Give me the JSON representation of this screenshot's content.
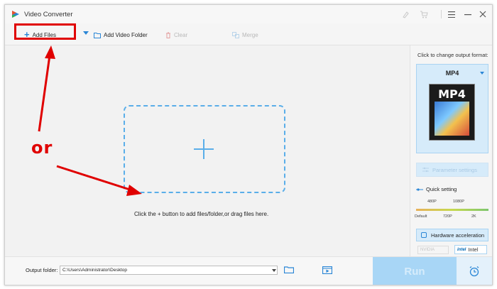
{
  "window": {
    "title": "Video Converter"
  },
  "toolbar": {
    "add_files": "Add Files",
    "add_video_folder": "Add Video Folder",
    "clear": "Clear",
    "merge": "Merge"
  },
  "main": {
    "hint": "Click the + button to add files/folder,or drag files here."
  },
  "annotation": {
    "or_label": "or",
    "highlight_color": "#e00000"
  },
  "sidebar": {
    "format_prompt": "Click to change output format:",
    "format_name": "MP4",
    "format_icon_text": "MP4",
    "parameter_settings": "Parameter settings",
    "quick_setting": "Quick setting",
    "slider_top_labels": [
      "480P",
      "1080P"
    ],
    "slider_bottom_labels": [
      "Default",
      "720P",
      "2K"
    ],
    "hardware_acceleration": "Hardware acceleration",
    "nvidia": "NVIDIA",
    "intel": "Intel",
    "intel_logo": "intel"
  },
  "bottom": {
    "output_folder_label": "Output folder:",
    "output_folder_value": "C:\\Users\\Administrator\\Desktop",
    "run_label": "Run"
  },
  "colors": {
    "accent": "#2a86d6",
    "drop_zone": "#5aaee9",
    "run_button": "#a8d6f6",
    "format_card": "#d6ebfa"
  },
  "icons": {
    "app": "app-logo-icon",
    "theme": "brush-icon",
    "cart": "cart-icon",
    "menu": "menu-icon",
    "minimize": "minimize-icon",
    "close": "close-icon",
    "folder": "folder-icon",
    "video": "video-icon",
    "alarm": "alarm-clock-icon"
  }
}
